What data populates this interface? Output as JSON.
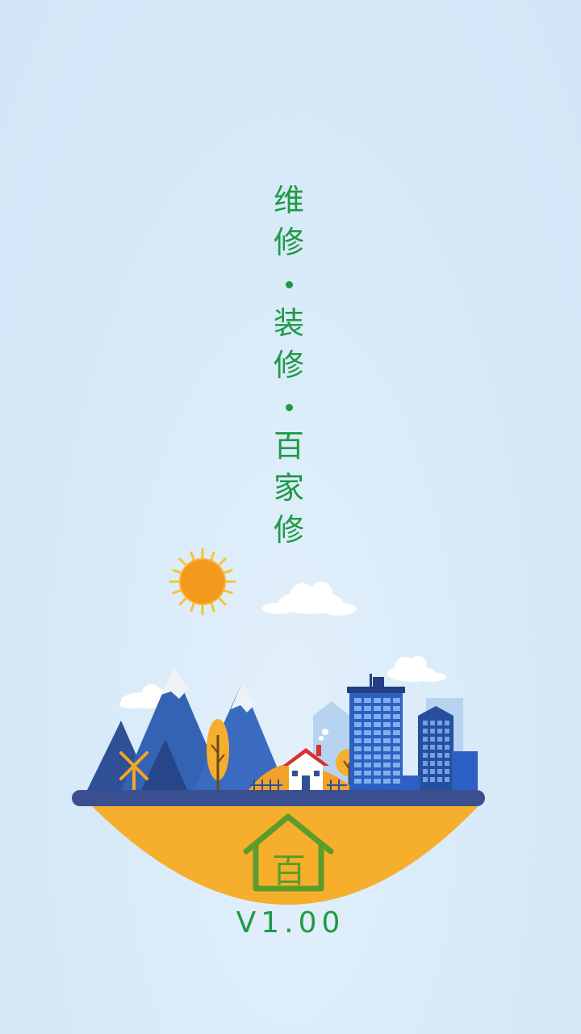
{
  "slogan": {
    "part1": [
      "维",
      "修"
    ],
    "part2": [
      "装",
      "修"
    ],
    "part3": [
      "百",
      "家",
      "修"
    ],
    "separator": "•"
  },
  "logo": {
    "icon": "house-logo-icon",
    "glyph": "百"
  },
  "version": "V1.00",
  "colors": {
    "background": "#d6e9f8",
    "text_green": "#1f9a45",
    "island_orange": "#f6ae2d",
    "island_rim": "#3a4f8f",
    "sun": "#f39a1d",
    "building_blue": "#2d5fc4",
    "mountain_blue": "#3563b3"
  }
}
